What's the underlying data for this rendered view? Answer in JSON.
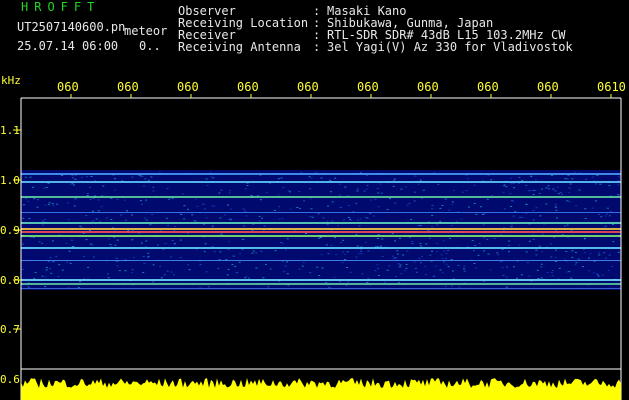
{
  "header": {
    "app_title": "HROFFT",
    "file_name": "UT2507140600.pn",
    "meteor_label": "meteor",
    "datetime": "25.07.14 06:00",
    "counter": "0.."
  },
  "meta": [
    {
      "label": "Observer",
      "value": "Masaki Kano"
    },
    {
      "label": "Receiving Location",
      "value": "Shibukawa, Gunma, Japan"
    },
    {
      "label": "Receiver",
      "value": "RTL-SDR SDR# 43dB L15 103.2MHz CW"
    },
    {
      "label": "Receiving Antenna",
      "value": "3el Yagi(V) Az 330 for Vladivostok"
    }
  ],
  "axis": {
    "y_unit": "kHz",
    "y_ticks": [
      "1.1",
      "1.0",
      "0.9",
      "0.8",
      "0.7",
      "0.6"
    ],
    "x_ticks": [
      "060",
      "060",
      "060",
      "060",
      "060",
      "060",
      "060",
      "060",
      "060",
      "0610"
    ]
  },
  "colors": {
    "axis_text": "#ffff33",
    "title": "#22d622",
    "background": "#000000",
    "waterfall_bg": "#000a6e",
    "level_bar": "#ffff00"
  }
}
